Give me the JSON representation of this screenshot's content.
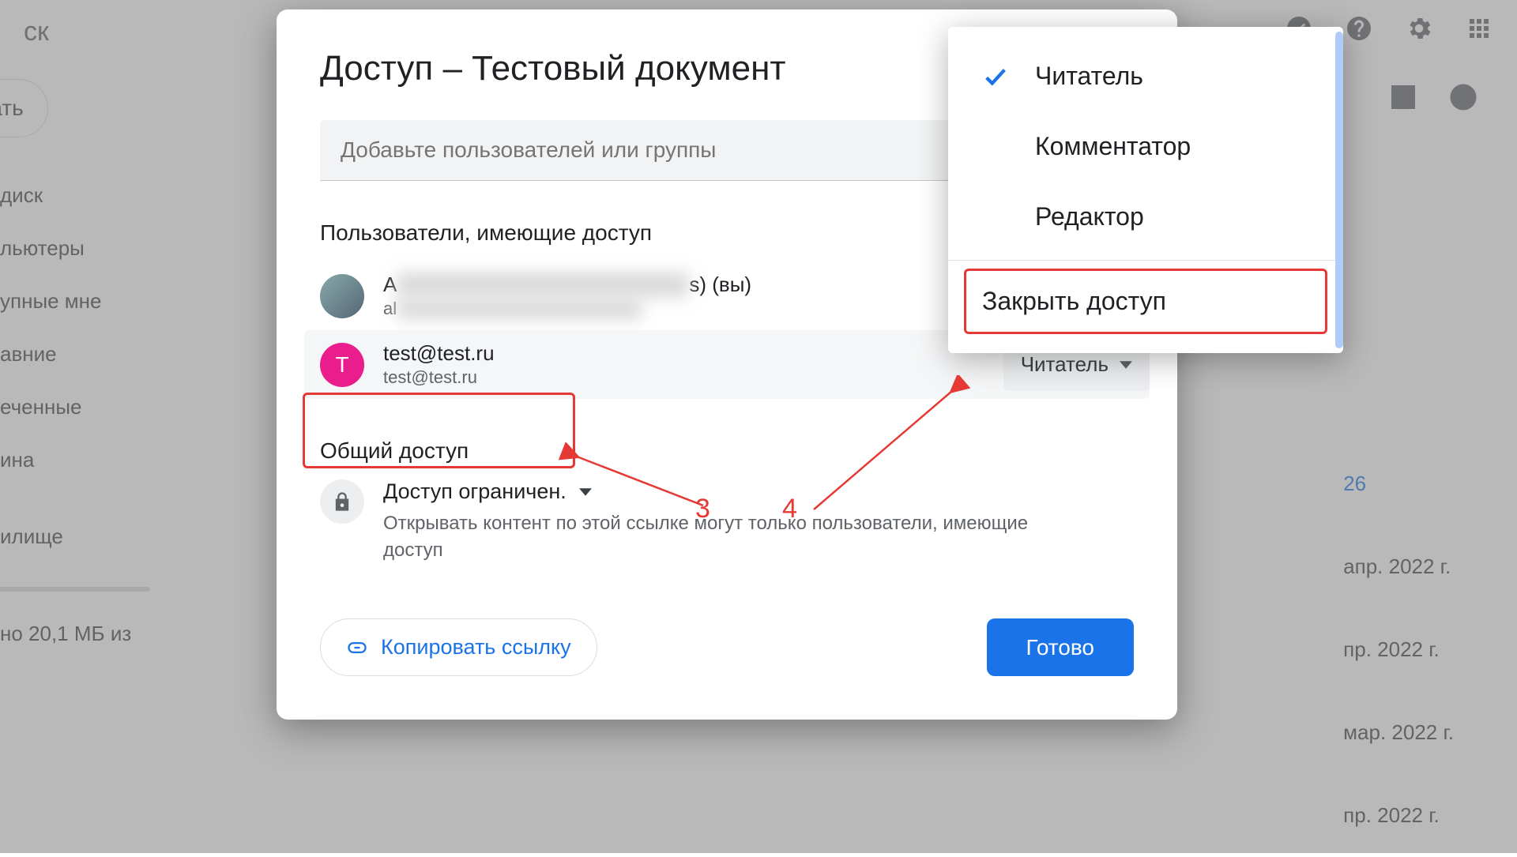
{
  "bg": {
    "title_fragment": "ск",
    "create": "дать",
    "sidebar": [
      "диск",
      "льютеры",
      "упные мне",
      "авние",
      "еченные",
      "ина",
      "илище"
    ],
    "storage": "но 20,1 МБ из",
    "dates": [
      "26",
      "апр. 2022 г.",
      "пр. 2022 г.",
      "мар. 2022 г.",
      "пр. 2022 г."
    ]
  },
  "dialog": {
    "title": "Доступ – Тестовый документ",
    "add_placeholder": "Добавьте пользователей или группы",
    "people_heading": "Пользователи, имеющие доступ",
    "owner": {
      "name_prefix": "A",
      "name_suffix": "s) (вы)",
      "email_prefix": "al"
    },
    "guest": {
      "name": "test@test.ru",
      "email": "test@test.ru",
      "avatar_letter": "T",
      "role": "Читатель"
    },
    "general_heading": "Общий доступ",
    "general_title": "Доступ ограничен.",
    "general_desc": "Открывать контент по этой ссылке могут только пользователи, имеющие доступ",
    "copy_link": "Копировать ссылку",
    "done": "Готово"
  },
  "menu": {
    "items": [
      "Читатель",
      "Комментатор",
      "Редактор"
    ],
    "selected_index": 0,
    "remove": "Закрыть доступ"
  },
  "annotations": {
    "left": "3",
    "right": "4"
  }
}
